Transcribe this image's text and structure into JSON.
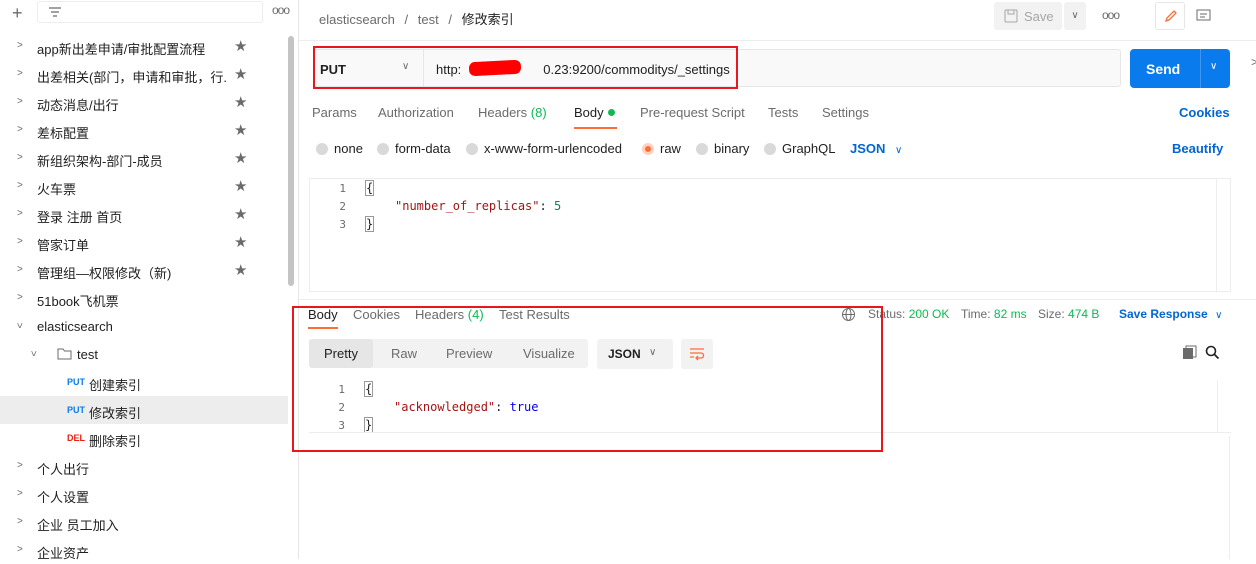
{
  "sidebar": {
    "items": [
      {
        "label": "app新出差申请/审批配置流程",
        "type": "folder"
      },
      {
        "label": "出差相关(部门，申请和审批，行...",
        "type": "folder"
      },
      {
        "label": "动态消息/出行",
        "type": "folder"
      },
      {
        "label": "差标配置",
        "type": "folder"
      },
      {
        "label": "新组织架构-部门-成员",
        "type": "folder"
      },
      {
        "label": "火车票",
        "type": "folder"
      },
      {
        "label": "登录 注册 首页",
        "type": "folder"
      },
      {
        "label": "管家订单",
        "type": "folder"
      },
      {
        "label": "管理组—权限修改（新)",
        "type": "folder"
      },
      {
        "label": "51book飞机票",
        "type": "folder"
      },
      {
        "label": "elasticsearch",
        "type": "folder"
      },
      {
        "label": "test",
        "type": "subfolder"
      },
      {
        "label": "创建索引",
        "method": "PUT"
      },
      {
        "label": "修改索引",
        "method": "PUT"
      },
      {
        "label": "删除索引",
        "method": "DEL"
      },
      {
        "label": "个人出行",
        "type": "folder"
      },
      {
        "label": "个人设置",
        "type": "folder"
      },
      {
        "label": "企业 员工加入",
        "type": "folder"
      },
      {
        "label": "企业资产",
        "type": "folder"
      }
    ]
  },
  "breadcrumb": {
    "root": "elasticsearch",
    "sep": "/",
    "folder": "test",
    "current": "修改索引"
  },
  "toolbar": {
    "save_label": "Save",
    "more": "ooo"
  },
  "request": {
    "method": "PUT",
    "url_prefix": "http:",
    "url_suffix": "0.23:9200/commoditys/_settings",
    "send_label": "Send"
  },
  "tabs": {
    "params": "Params",
    "authorization": "Authorization",
    "headers": "Headers",
    "headers_count": "(8)",
    "body": "Body",
    "prerequest": "Pre-request Script",
    "tests": "Tests",
    "settings": "Settings",
    "cookies": "Cookies"
  },
  "body_modes": {
    "none": "none",
    "form_data": "form-data",
    "urlencoded": "x-www-form-urlencoded",
    "raw": "raw",
    "binary": "binary",
    "graphql": "GraphQL",
    "language": "JSON",
    "beautify": "Beautify"
  },
  "request_body": {
    "lines": [
      "1",
      "2",
      "3"
    ],
    "open": "{",
    "key": "\"number_of_replicas\"",
    "colon": ": ",
    "value": "5",
    "close": "}"
  },
  "response": {
    "tabs": {
      "body": "Body",
      "cookies": "Cookies",
      "headers": "Headers",
      "headers_count": "(4)",
      "test_results": "Test Results"
    },
    "status_label": "Status:",
    "status_value": "200 OK",
    "time_label": "Time:",
    "time_value": "82 ms",
    "size_label": "Size:",
    "size_value": "474 B",
    "save_response": "Save Response",
    "views": {
      "pretty": "Pretty",
      "raw": "Raw",
      "preview": "Preview",
      "visualize": "Visualize"
    },
    "format": "JSON",
    "lines": [
      "1",
      "2",
      "3"
    ],
    "open": "{",
    "key": "\"acknowledged\"",
    "colon": ": ",
    "value": "true",
    "close": "}"
  },
  "colors": {
    "accent": "#ff6c37",
    "send": "#097bed",
    "link": "#0265d2",
    "success": "#0cbb52",
    "highlight_box": "#e8161d"
  }
}
